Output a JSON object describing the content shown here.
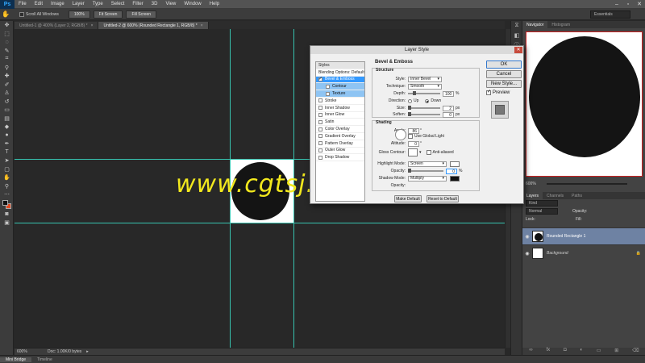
{
  "app": {
    "logo": "Ps"
  },
  "menubar": {
    "items": [
      "File",
      "Edit",
      "Image",
      "Layer",
      "Type",
      "Select",
      "Filter",
      "3D",
      "View",
      "Window",
      "Help"
    ],
    "minimize": "–",
    "maximize": "▫",
    "close": "✕"
  },
  "options": {
    "scroll_all": "Scroll All Windows",
    "zoom100": "100%",
    "fit_screen": "Fit Screen",
    "fill_screen": "Fill Screen",
    "workspace": "Essentials"
  },
  "tabs": [
    {
      "label": "Untitled-1 @ 400% (Layer 2, RGB/8) *",
      "close": "×"
    },
    {
      "label": "Untitled-2 @ 600% (Rounded Rectangle 1, RGB/8) *",
      "close": "×"
    }
  ],
  "status": {
    "zoom": "600%",
    "doc": "Doc: 1.00K/0 bytes"
  },
  "bottom_tabs": {
    "mini_bridge": "Mini Bridge",
    "timeline": "Timeline"
  },
  "watermark": "www.cgtsj.com",
  "navigator": {
    "tab1": "Navigator",
    "tab2": "Histogram"
  },
  "layers": {
    "tab1": "Layers",
    "tab2": "Channels",
    "tab3": "Paths",
    "kind": "Kind",
    "mode": "Normal",
    "opacity_label": "Opacity:",
    "fill_label": "Fill:",
    "lock_label": "Lock:",
    "items": [
      {
        "name": "Rounded Rectangle 1",
        "selected": true
      },
      {
        "name": "Background",
        "selected": false
      }
    ]
  },
  "dialog": {
    "title": "Layer Style",
    "styles_header": "Styles",
    "styles": [
      {
        "label": "Blending Options: Default",
        "type": "head"
      },
      {
        "label": "Bevel & Emboss",
        "type": "sel",
        "checked": true
      },
      {
        "label": "Contour",
        "type": "sub"
      },
      {
        "label": "Texture",
        "type": "sub"
      },
      {
        "label": "Stroke",
        "type": "item"
      },
      {
        "label": "Inner Shadow",
        "type": "item"
      },
      {
        "label": "Inner Glow",
        "type": "item"
      },
      {
        "label": "Satin",
        "type": "item"
      },
      {
        "label": "Color Overlay",
        "type": "item"
      },
      {
        "label": "Gradient Overlay",
        "type": "item"
      },
      {
        "label": "Pattern Overlay",
        "type": "item"
      },
      {
        "label": "Outer Glow",
        "type": "item"
      },
      {
        "label": "Drop Shadow",
        "type": "item"
      }
    ],
    "section_title": "Bevel & Emboss",
    "structure": "Structure",
    "style_label": "Style:",
    "style_value": "Inner Bevel",
    "technique_label": "Technique:",
    "technique_value": "Smooth",
    "depth_label": "Depth:",
    "depth_value": "100",
    "depth_unit": "%",
    "direction_label": "Direction:",
    "dir_up": "Up",
    "dir_down": "Down",
    "size_label": "Size:",
    "size_value": "2",
    "size_unit": "px",
    "soften_label": "Soften:",
    "soften_value": "0",
    "soften_unit": "px",
    "shading": "Shading",
    "angle_label": "Angle:",
    "angle_value": "86",
    "angle_unit": "°",
    "global_light": "Use Global Light",
    "altitude_label": "Altitude:",
    "altitude_value": "0",
    "altitude_unit": "°",
    "gloss_label": "Gloss Contour:",
    "anti_aliased": "Anti-aliased",
    "highlight_label": "Highlight Mode:",
    "highlight_value": "Screen",
    "opacity_label": "Opacity:",
    "opacity_value": "0",
    "opacity_unit": "%",
    "shadow_label": "Shadow Mode:",
    "shadow_value": "Multiply",
    "opacity2_label": "Opacity:",
    "make_default": "Make Default",
    "reset_default": "Reset to Default",
    "ok": "OK",
    "cancel": "Cancel",
    "new_style": "New Style...",
    "preview": "Preview"
  },
  "colors": {
    "accent": "#3399ff",
    "guide": "#37c3b0",
    "watermark": "#f2e81d"
  }
}
